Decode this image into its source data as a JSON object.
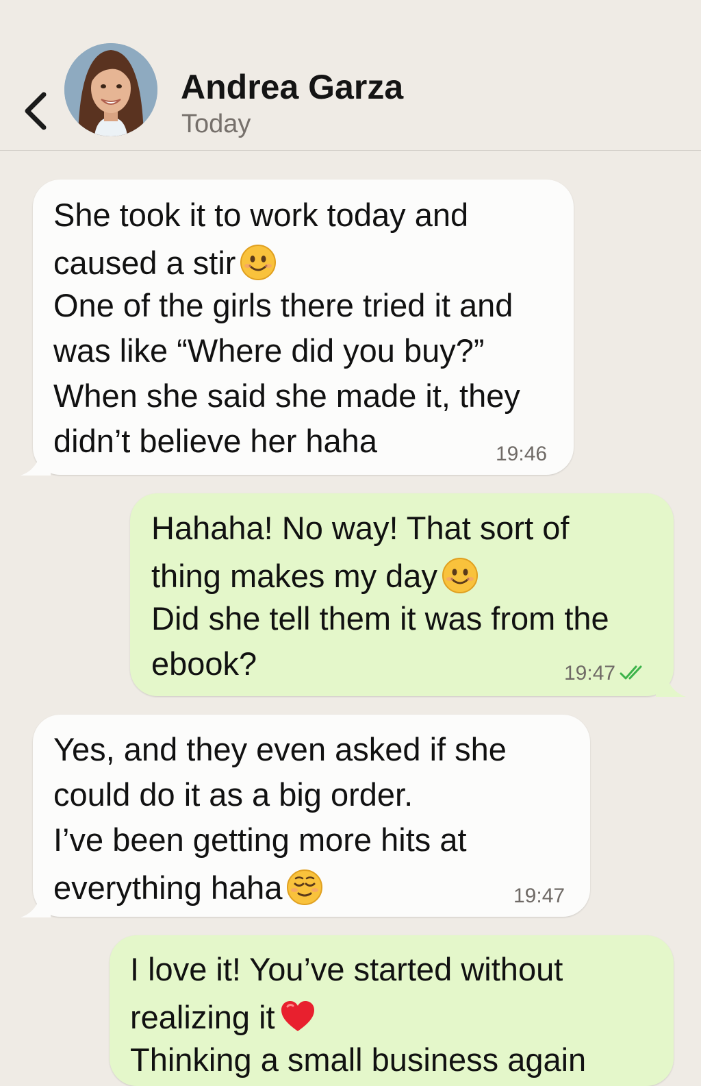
{
  "header": {
    "back_icon": "chevron-left-icon",
    "contact_name": "Andrea Garza",
    "status": "Today"
  },
  "colors": {
    "background": "#efebe5",
    "incoming_bubble": "#fcfcfb",
    "outgoing_bubble": "#e4f7ca",
    "read_ticks": "#3cb34a"
  },
  "messages": [
    {
      "direction": "incoming",
      "lines": [
        "She took it to work today and",
        "caused a stir",
        "One of the girls there tried it and",
        "was like “Where did you buy?”",
        "When she said she made it, they",
        "didn’t believe her haha"
      ],
      "emoji": "smiling-face-icon",
      "time": "19:46"
    },
    {
      "direction": "outgoing",
      "lines": [
        "Hahaha! No way! That sort of",
        "thing makes my day",
        "Did she tell them it was from the",
        "ebook?"
      ],
      "emoji": "smiling-face-icon",
      "time": "19:47",
      "status_icon": "double-check-icon"
    },
    {
      "direction": "incoming",
      "lines": [
        "Yes, and they even asked if she",
        "could do it as a big order.",
        "I’ve been getting more hits at",
        "everything haha"
      ],
      "emoji": "relieved-face-icon",
      "time": "19:47"
    },
    {
      "direction": "outgoing",
      "lines": [
        "I love it! You’ve started without",
        "realizing it",
        "Thinking a small business again"
      ],
      "emoji": "red-heart-icon"
    }
  ]
}
